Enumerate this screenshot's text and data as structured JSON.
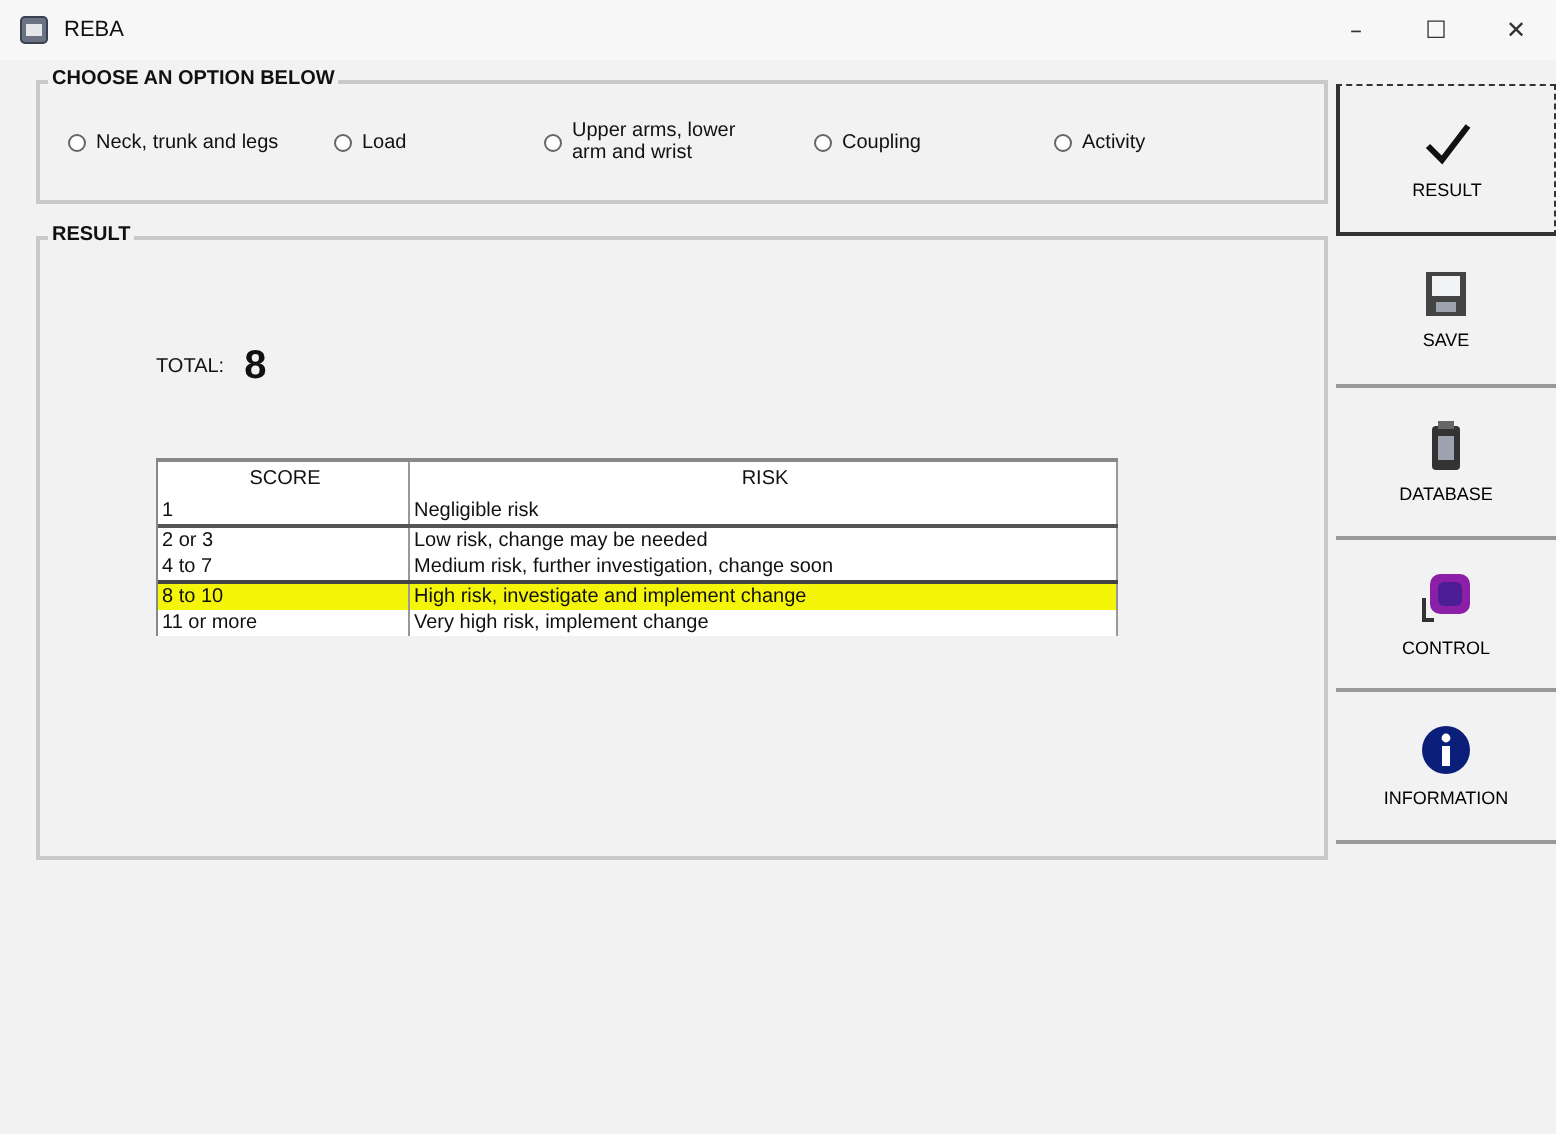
{
  "window": {
    "title": "REBA",
    "controls": [
      "–",
      "☐",
      "✕"
    ]
  },
  "options_group": {
    "title": "CHOOSE AN OPTION BELOW",
    "options": [
      {
        "label": "Neck, trunk and legs",
        "checked": false
      },
      {
        "label": "Load",
        "checked": false
      },
      {
        "label": "Upper arms, lower\narm and wrist",
        "checked": false
      },
      {
        "label": "Coupling",
        "checked": false
      },
      {
        "label": "Activity",
        "checked": false
      }
    ]
  },
  "result_group": {
    "title": "RESULT",
    "total_label": "TOTAL:",
    "total_value": "8",
    "table": {
      "columns": [
        "SCORE",
        "RISK"
      ],
      "rows": [
        {
          "score": "1",
          "risk": "Negligible risk",
          "selected": false
        },
        {
          "score": "2 or 3",
          "risk": "Low risk, change may be needed",
          "selected": false
        },
        {
          "score": "4 to 7",
          "risk": "Medium risk, further investigation, change soon",
          "selected": false
        },
        {
          "score": "8 to 10",
          "risk": "High risk, investigate and implement change",
          "selected": true
        },
        {
          "score": "11 or more",
          "risk": "Very high risk, implement change",
          "selected": false
        }
      ]
    }
  },
  "side_buttons": [
    {
      "kind": "check",
      "label": "RESULT",
      "focused": true
    },
    {
      "kind": "save",
      "label": "SAVE",
      "focused": false
    },
    {
      "kind": "database",
      "label": "DATABASE",
      "focused": false
    },
    {
      "kind": "control",
      "label": "CONTROL",
      "focused": false
    },
    {
      "kind": "info",
      "label": "INFORMATION",
      "focused": false
    }
  ]
}
